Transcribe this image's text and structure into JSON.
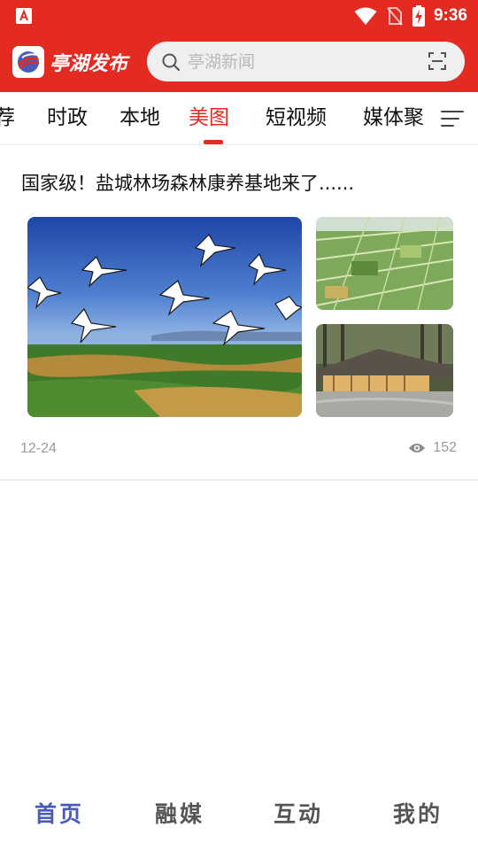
{
  "status_bar": {
    "time": "9:36",
    "icons": [
      "app-notification-icon",
      "wifi-icon",
      "no-sim-icon",
      "battery-charging-icon"
    ]
  },
  "header": {
    "app_name": "亭湖发布",
    "search": {
      "placeholder": "亭湖新闻",
      "value": ""
    },
    "icons": [
      "app-logo-icon",
      "search-icon",
      "scan-icon"
    ]
  },
  "tabs": {
    "items": [
      {
        "label": "荐"
      },
      {
        "label": "时政"
      },
      {
        "label": "本地"
      },
      {
        "label": "美图",
        "active": true
      },
      {
        "label": "短视频"
      },
      {
        "label": "媒体聚"
      }
    ],
    "menu_icon": "menu-lines-icon",
    "accent_color": "#e32b22"
  },
  "feed": {
    "articles": [
      {
        "title": "国家级！盐城林场森林康养基地来了......",
        "images": [
          "cranes-flying-over-wetland",
          "aerial-green-farmland",
          "forest-lodge-building"
        ],
        "date": "12-24",
        "views": "152",
        "view_icon": "eye-icon"
      }
    ]
  },
  "bottom_nav": {
    "items": [
      {
        "label": "首页",
        "active": true
      },
      {
        "label": "融媒"
      },
      {
        "label": "互动"
      },
      {
        "label": "我的"
      }
    ],
    "active_color": "#4a5ab8"
  },
  "colors": {
    "brand_red": "#e32b22",
    "muted_text": "#9a9a9a"
  }
}
